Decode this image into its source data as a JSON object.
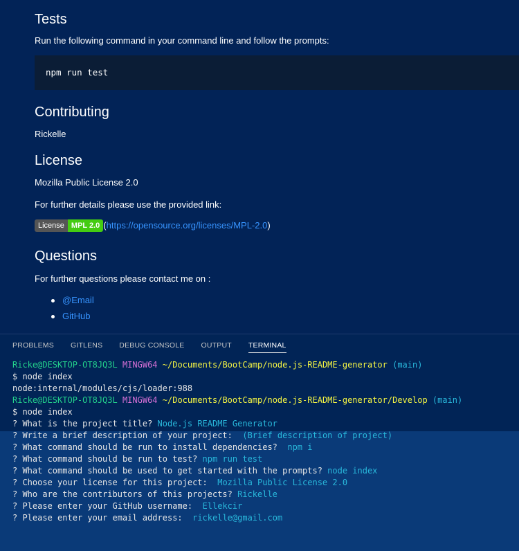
{
  "preview": {
    "tests": {
      "heading": "Tests",
      "instruction": "Run the following command in your command line and follow the prompts:",
      "code": "npm run test"
    },
    "contributing": {
      "heading": "Contributing",
      "text": "Rickelle"
    },
    "license": {
      "heading": "License",
      "text": "Mozilla Public License 2.0",
      "details": "For further details please use the provided link:",
      "badge_left": "License",
      "badge_right": "MPL 2.0",
      "link_open": "(",
      "link_text": "https://opensource.org/licenses/MPL-2.0",
      "link_close": ")"
    },
    "questions": {
      "heading": "Questions",
      "text": "For further questions please contact me on :",
      "links": [
        "@Email",
        "GitHub"
      ]
    }
  },
  "panel": {
    "tabs": [
      "PROBLEMS",
      "GITLENS",
      "DEBUG CONSOLE",
      "OUTPUT",
      "TERMINAL"
    ],
    "active_tab": "TERMINAL"
  },
  "terminal": {
    "prompt1": {
      "user": "Ricke@DESKTOP-OT8JQ3L",
      "shell": "MINGW64",
      "path": "~/Documents/BootCamp/node.js-README-generator",
      "branch": "(main)"
    },
    "cmd1": "$ node index",
    "error_line": "node:internal/modules/cjs/loader:988",
    "prompt2": {
      "user": "Ricke@DESKTOP-OT8JQ3L",
      "shell": "MINGW64",
      "path": "~/Documents/BootCamp/node.js-README-generator/Develop",
      "branch": "(main)"
    },
    "cmd2": "$ node index",
    "questions": [
      {
        "q": "? What is the project title? ",
        "a": "Node.js README Generator"
      },
      {
        "q": "? Write a brief description of your project:  ",
        "a": "(Brief description of project)"
      },
      {
        "q": "? What command should be run to install dependencies?  ",
        "a": "npm i"
      },
      {
        "q": "? What command should be run to test? ",
        "a": "npm run test"
      },
      {
        "q": "? What command should be used to get started with the prompts? ",
        "a": "node index"
      },
      {
        "q": "? Choose your license for this project:  ",
        "a": "Mozilla Public License 2.0"
      },
      {
        "q": "? Who are the contributors of this projects? ",
        "a": "Rickelle"
      },
      {
        "q": "? Please enter your GitHub username:  ",
        "a": "Ellekcir"
      },
      {
        "q": "? Please enter your email address:  ",
        "a": "rickelle@gmail.com"
      }
    ]
  },
  "colors": {
    "background": "#012456",
    "link": "#3794ff",
    "user": "#23d18b",
    "shell": "#d670d6",
    "path": "#f5f543",
    "branch": "#29b8db",
    "badge_green": "#44cc11"
  }
}
